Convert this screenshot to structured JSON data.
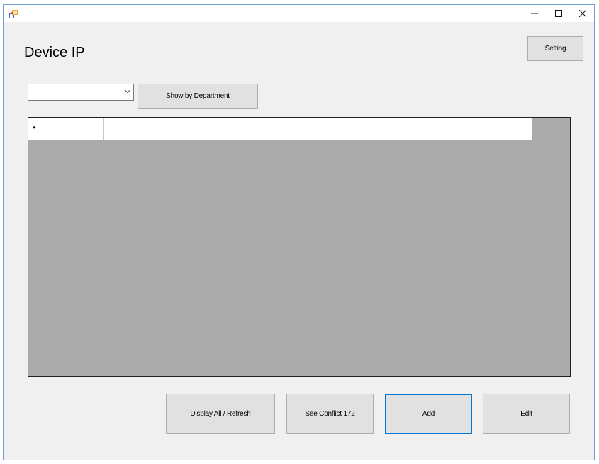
{
  "window": {
    "title": "",
    "controls": {
      "minimize": "—",
      "maximize": "☐",
      "close": "✕"
    }
  },
  "page": {
    "title": "Device IP"
  },
  "toolbar": {
    "setting_label": "Setting",
    "department_select_value": "",
    "show_by_department_label": "Show by Department"
  },
  "grid": {
    "new_row_marker": "*",
    "columns": [
      "",
      "",
      "",
      "",
      "",
      "",
      "",
      "",
      ""
    ]
  },
  "actions": {
    "display_all_label": "Display All / Refresh",
    "see_conflict_label": "See Conflict 172",
    "add_label": "Add",
    "edit_label": "Edit"
  },
  "colors": {
    "focus": "#0078d7",
    "grid_bg": "#ababab",
    "window_bg": "#f0f0f0"
  }
}
